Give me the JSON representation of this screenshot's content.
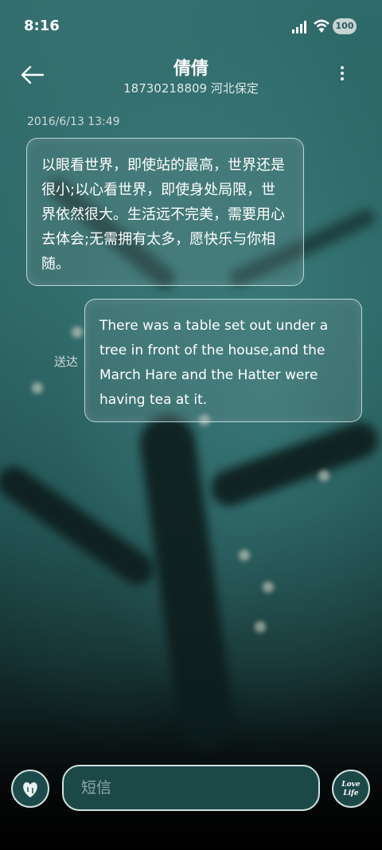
{
  "status": {
    "time": "8:16",
    "battery": "100"
  },
  "header": {
    "contact_name": "倩倩",
    "contact_info": "18730218809 河北保定"
  },
  "conversation": {
    "timestamp": "2016/6/13 13:49",
    "incoming_text": "以眼看世界，即使站的最高，世界还是很小;以心看世界，即使身处局限，世界依然很大。生活远不完美，需要用心去体会;无需拥有太多，愿快乐与你相随。",
    "outgoing_text": "There was a table set out under a tree in front of the house,and the March Hare and the Hatter were having tea at it.",
    "sent_label": "送达"
  },
  "composer": {
    "placeholder": "短信",
    "love_label_1": "Love",
    "love_label_2": "Life"
  },
  "icons": {
    "back": "back-arrow-icon",
    "more": "more-vert-icon",
    "heart": "heart-icon",
    "signal": "signal-icon",
    "wifi": "wifi-icon"
  }
}
